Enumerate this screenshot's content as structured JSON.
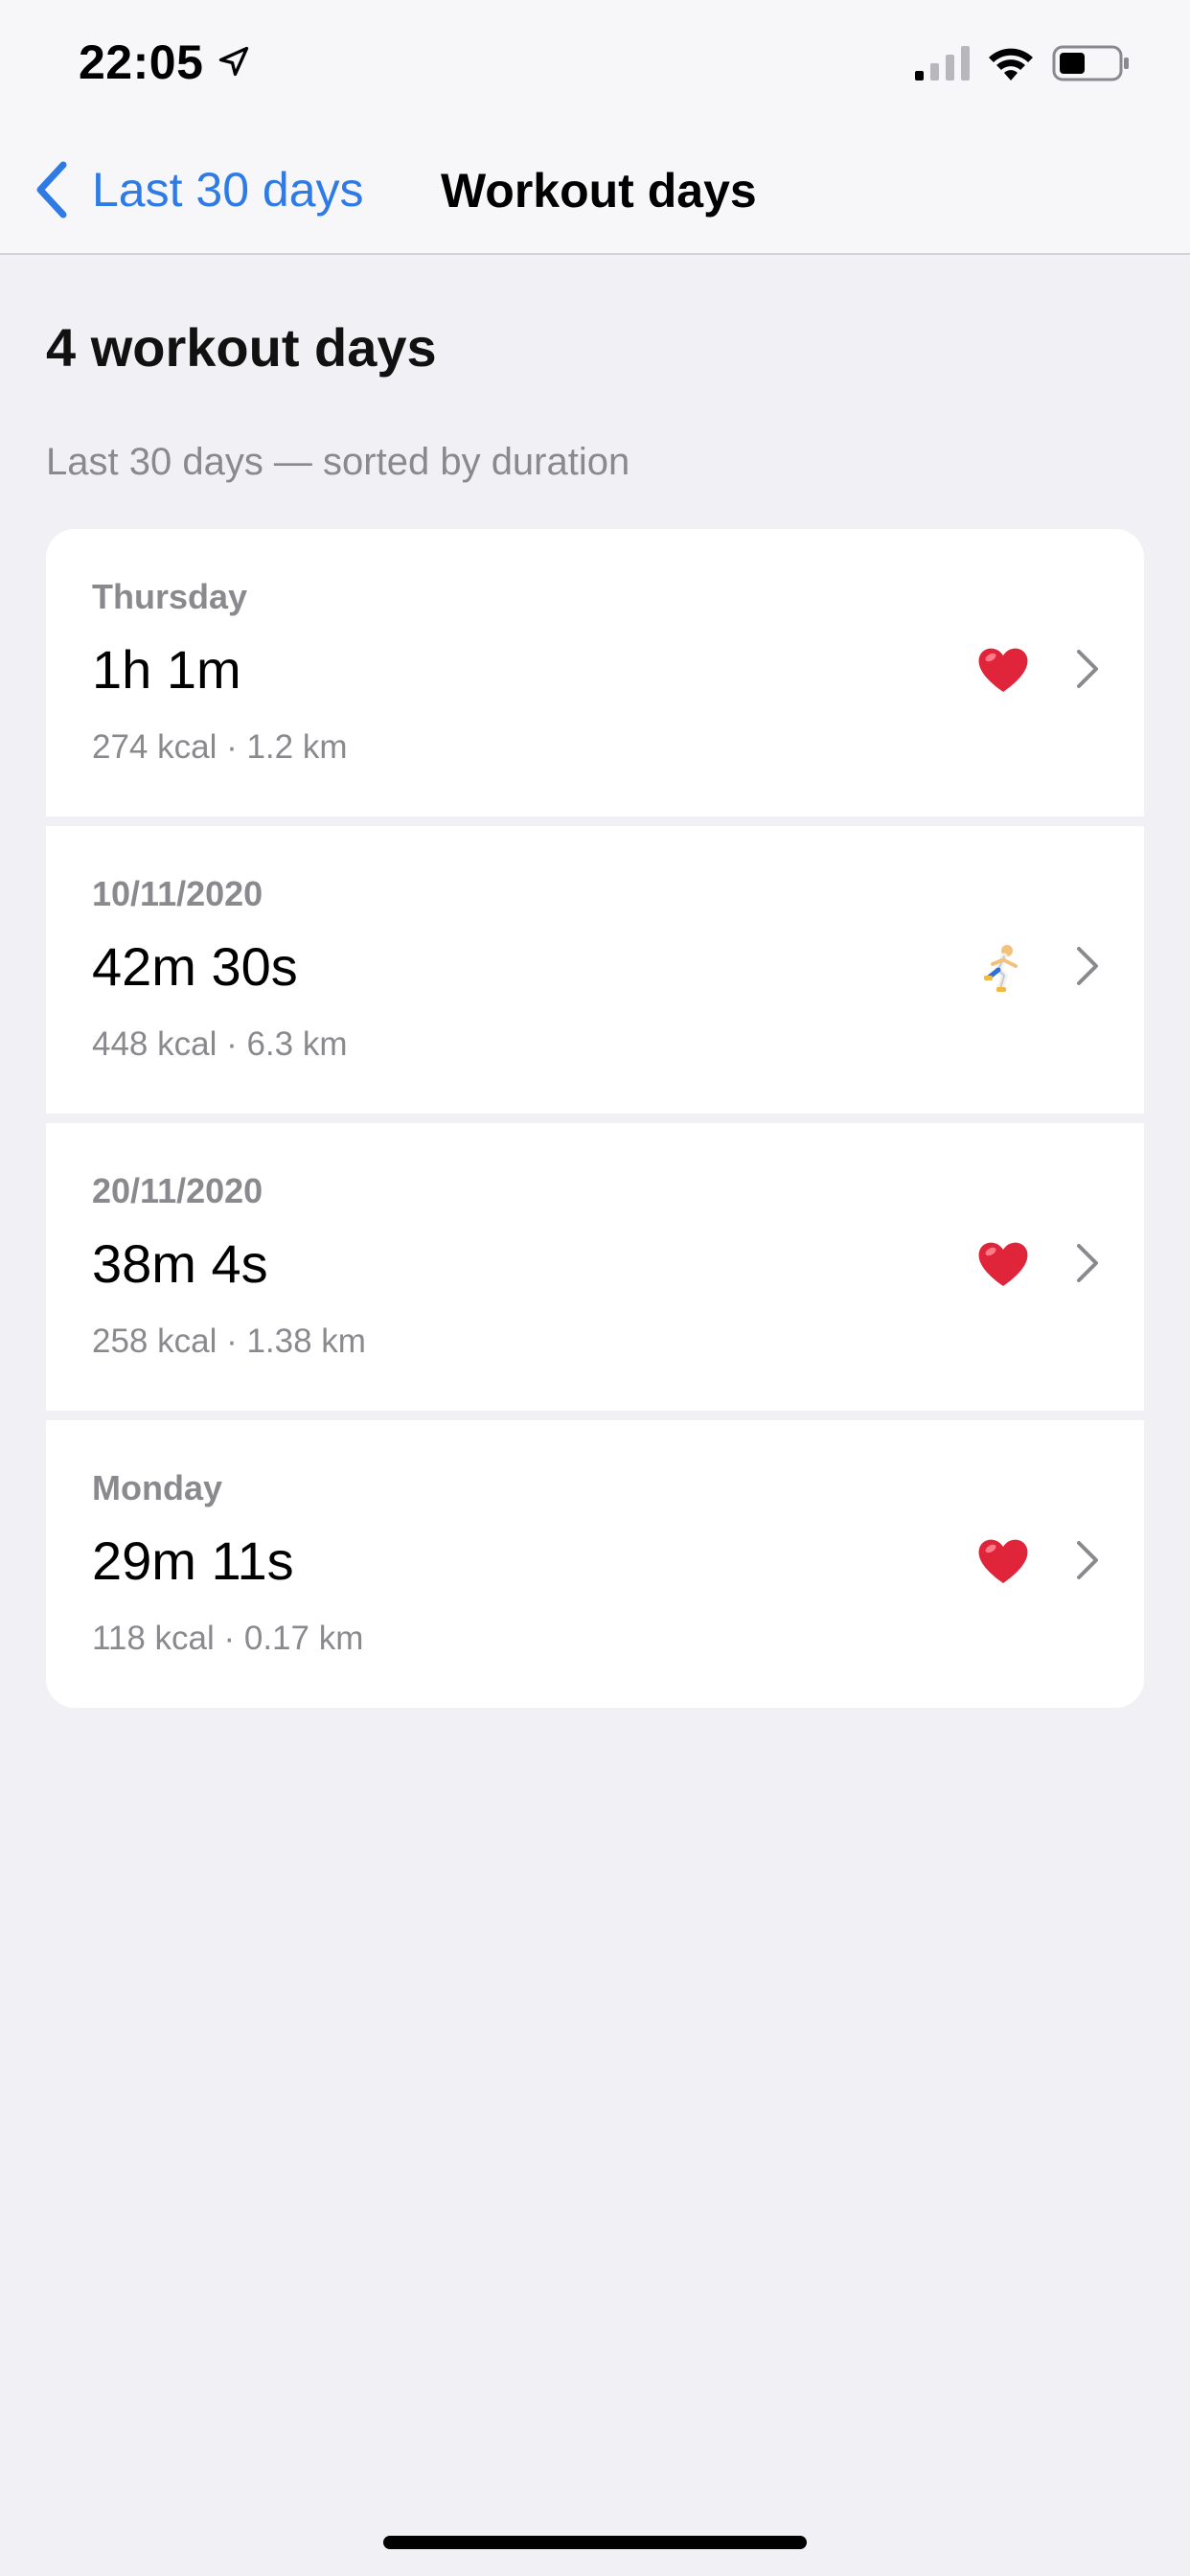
{
  "status_bar": {
    "time": "22:05",
    "icons": [
      "location-arrow-icon",
      "signal-icon",
      "wifi-icon",
      "battery-icon"
    ]
  },
  "nav": {
    "back_label": "Last 30 days",
    "title": "Workout days"
  },
  "header": {
    "heading": "4 workout days",
    "subtitle": "Last 30 days — sorted by duration"
  },
  "workouts": [
    {
      "day": "Thursday",
      "duration": "1h 1m",
      "detail": "274 kcal · 1.2 km",
      "icon": "heart-icon"
    },
    {
      "day": "10/11/2020",
      "duration": "42m 30s",
      "detail": "448 kcal · 6.3 km",
      "icon": "runner-icon"
    },
    {
      "day": "20/11/2020",
      "duration": "38m 4s",
      "detail": "258 kcal · 1.38 km",
      "icon": "heart-icon"
    },
    {
      "day": "Monday",
      "duration": "29m 11s",
      "detail": "118 kcal · 0.17 km",
      "icon": "heart-icon"
    }
  ],
  "colors": {
    "accent": "#2f7be6",
    "background": "#f0f0f5",
    "secondary_text": "#8a8a8e",
    "heart": "#e0243a"
  }
}
